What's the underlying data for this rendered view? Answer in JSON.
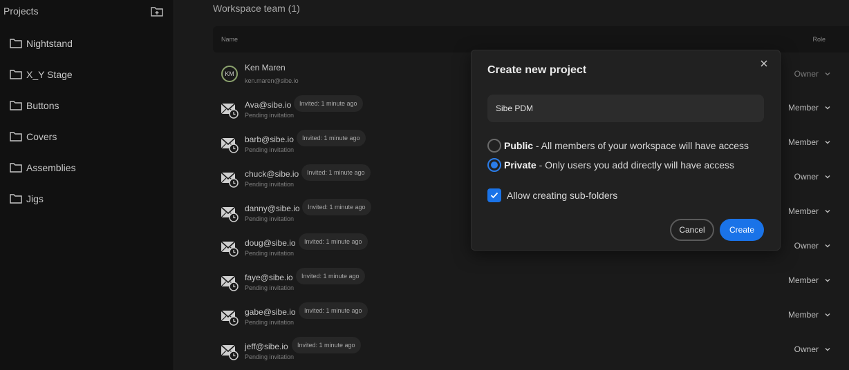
{
  "sidebar": {
    "title": "Projects",
    "items": [
      {
        "label": "Nightstand"
      },
      {
        "label": "X_Y Stage"
      },
      {
        "label": "Buttons"
      },
      {
        "label": "Covers"
      },
      {
        "label": "Assemblies"
      },
      {
        "label": "Jigs"
      }
    ]
  },
  "main": {
    "title": "Workspace team (1)",
    "columns": {
      "name": "Name",
      "role": "Role"
    },
    "owner": {
      "initials": "KM",
      "name": "Ken Maren",
      "email": "ken.maren@sibe.io",
      "role": "Owner"
    },
    "members": [
      {
        "email": "Ava@sibe.io",
        "badge": "Invited: 1 minute ago",
        "status": "Pending invitation",
        "role": "Member"
      },
      {
        "email": "barb@sibe.io",
        "badge": "Invited: 1 minute ago",
        "status": "Pending invitation",
        "role": "Member"
      },
      {
        "email": "chuck@sibe.io",
        "badge": "Invited: 1 minute ago",
        "status": "Pending invitation",
        "role": "Owner"
      },
      {
        "email": "danny@sibe.io",
        "badge": "Invited: 1 minute ago",
        "status": "Pending invitation",
        "role": "Member"
      },
      {
        "email": "doug@sibe.io",
        "badge": "Invited: 1 minute ago",
        "status": "Pending invitation",
        "role": "Owner"
      },
      {
        "email": "faye@sibe.io",
        "badge": "Invited: 1 minute ago",
        "status": "Pending invitation",
        "role": "Member"
      },
      {
        "email": "gabe@sibe.io",
        "badge": "Invited: 1 minute ago",
        "status": "Pending invitation",
        "role": "Member"
      },
      {
        "email": "jeff@sibe.io",
        "badge": "Invited: 1 minute ago",
        "status": "Pending invitation",
        "role": "Owner"
      }
    ]
  },
  "modal": {
    "title": "Create new project",
    "input_value": "Sibe PDM",
    "public_strong": "Public",
    "public_text": " - All members of your workspace will have access",
    "private_strong": "Private",
    "private_text": " - Only users you add directly will have access",
    "selected": "private",
    "subfolders_label": "Allow creating sub-folders",
    "subfolders_checked": true,
    "cancel_label": "Cancel",
    "create_label": "Create"
  },
  "colors": {
    "accent": "#1a73e8",
    "avatar_ring": "#8ca36e"
  },
  "icons": [
    "folder-icon",
    "add-folder-icon",
    "mail-clock-icon",
    "chevron-down-icon",
    "close-icon",
    "check-icon"
  ]
}
